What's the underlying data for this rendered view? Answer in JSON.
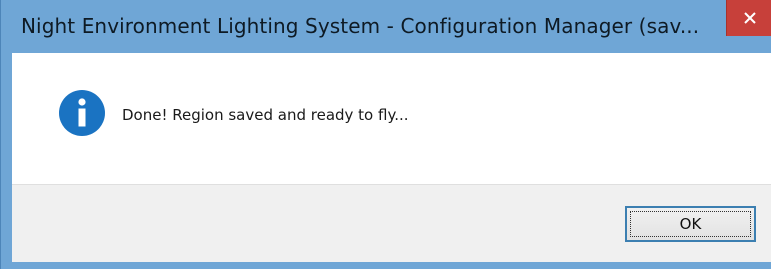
{
  "window": {
    "title": "Night Environment Lighting System - Configuration Manager (sav..."
  },
  "titlebar": {
    "close_icon": "close-icon",
    "close_color": "#c7403a"
  },
  "dialog": {
    "icon": "info-icon",
    "icon_color": "#1a73c2",
    "message": "Done! Region saved and ready to fly..."
  },
  "footer": {
    "ok_label": "OK"
  }
}
